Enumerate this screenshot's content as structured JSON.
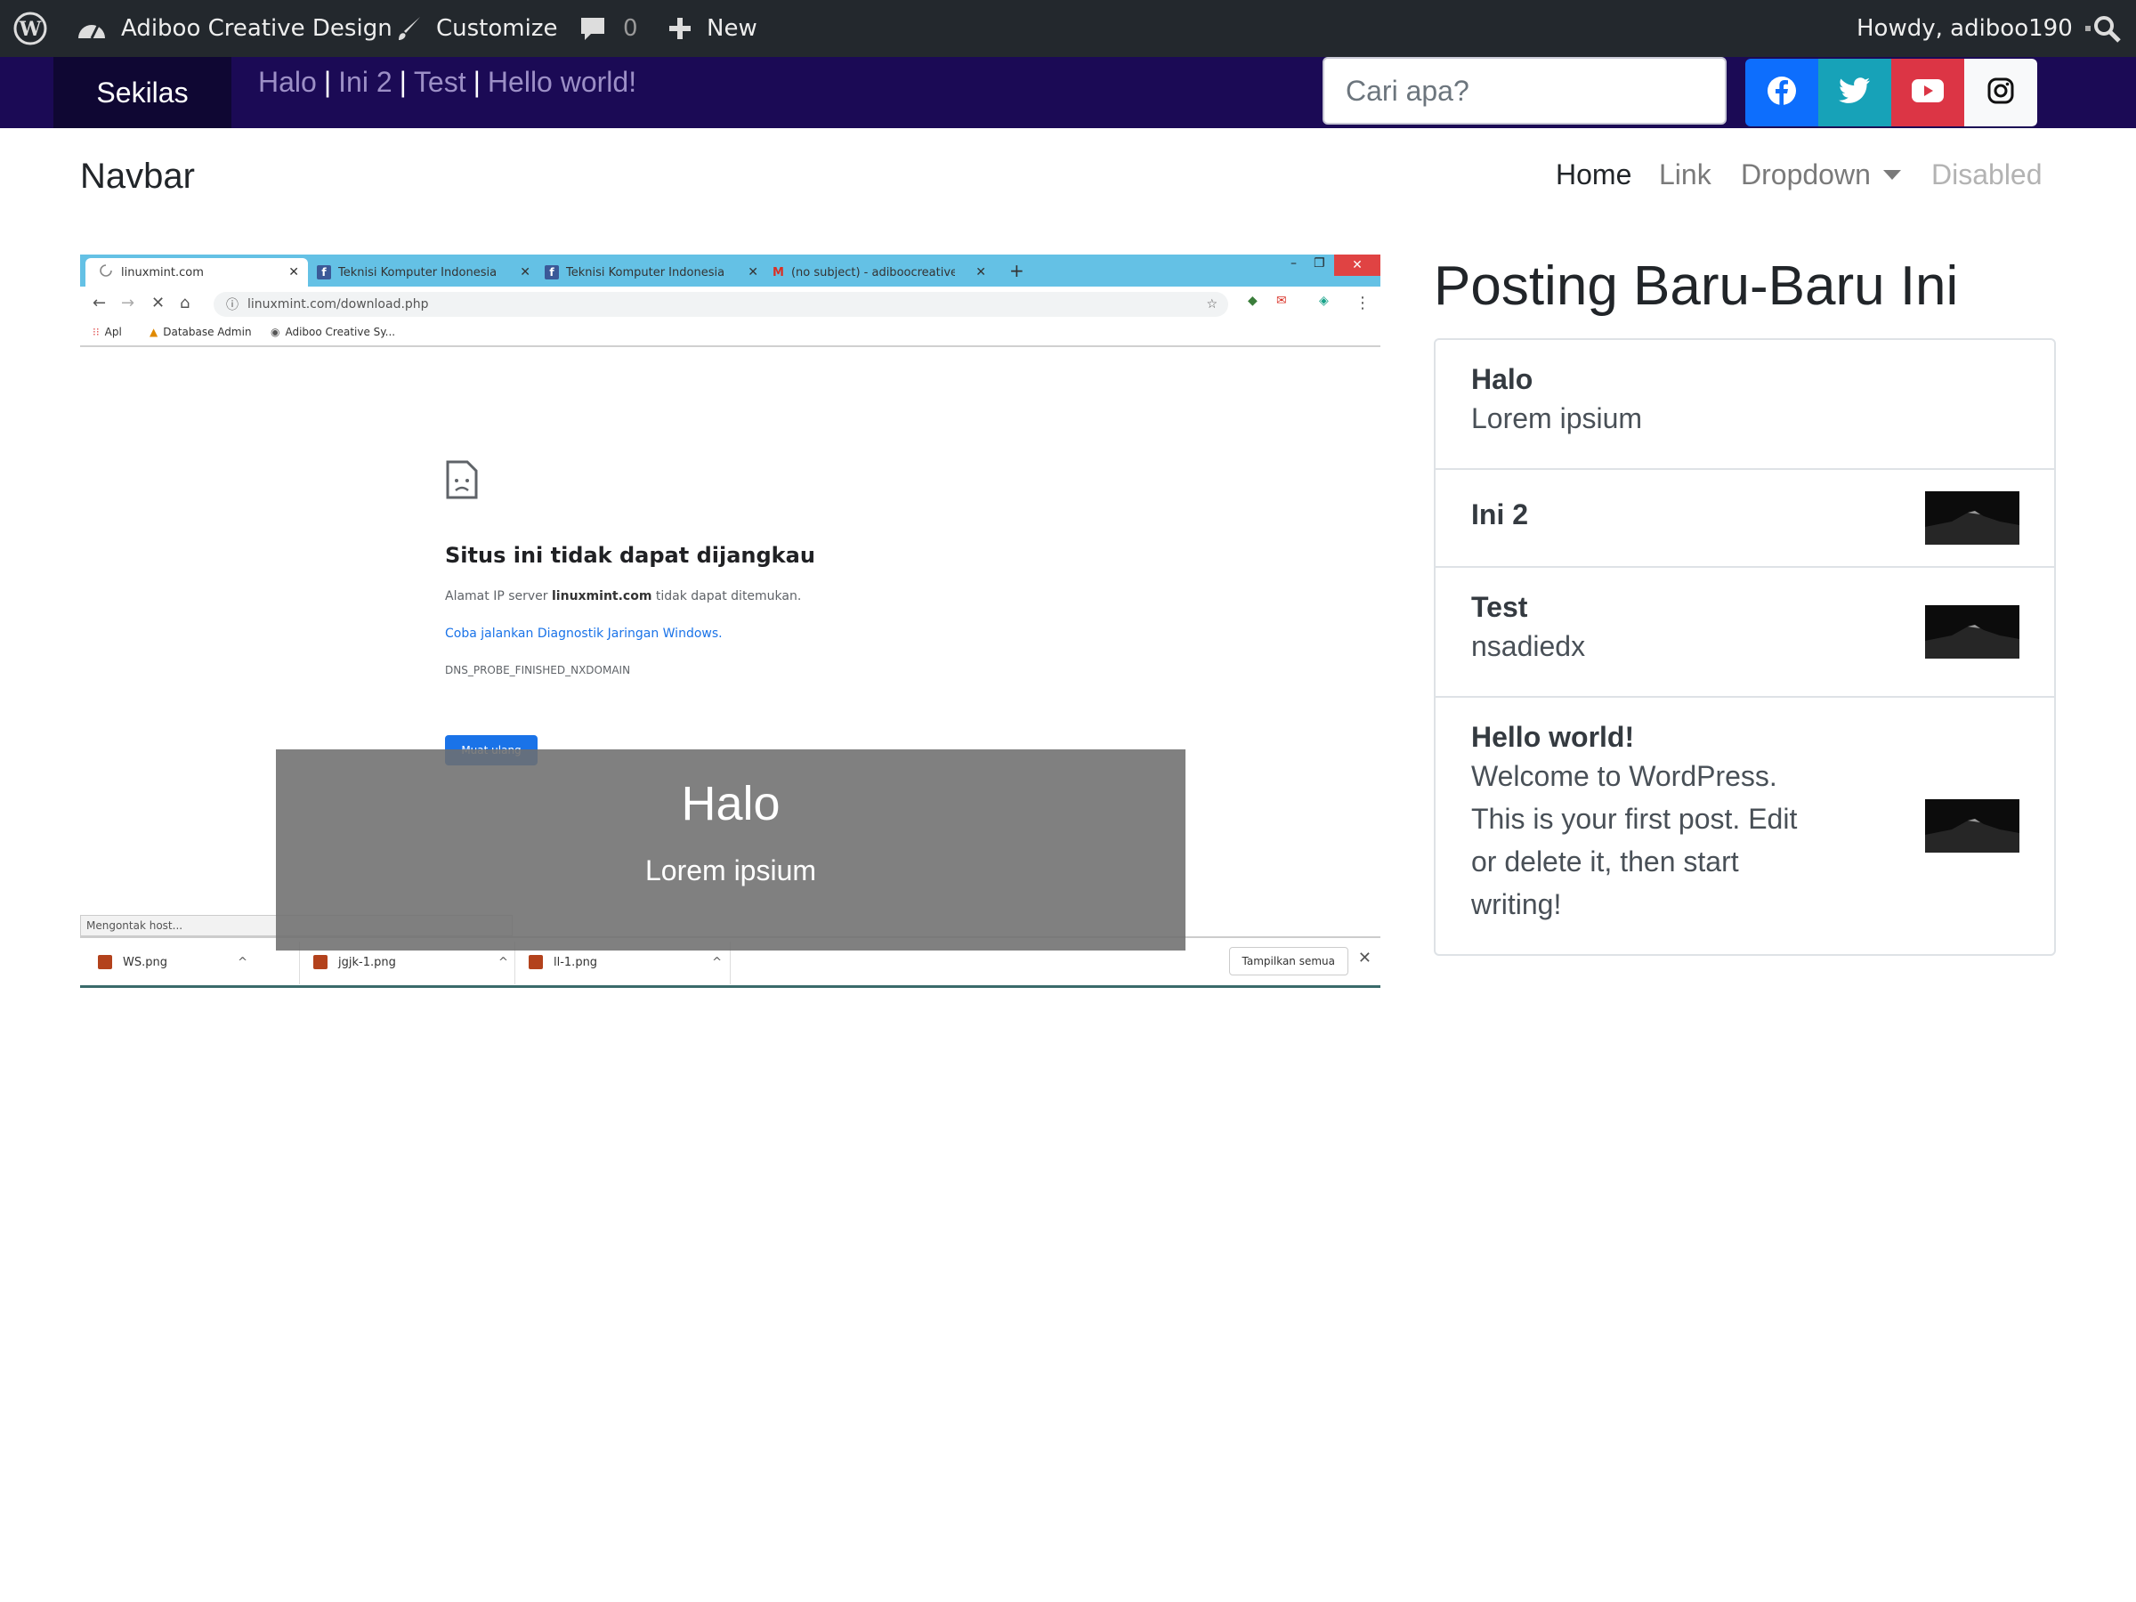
{
  "admin_bar": {
    "site_name": "Adiboo Creative Design",
    "customize": "Customize",
    "comments_count": "0",
    "new": "New",
    "howdy": "Howdy, adiboo190"
  },
  "top_bar": {
    "label": "Sekilas",
    "ticker": [
      "Halo",
      "Ini 2",
      "Test",
      "Hello world!"
    ],
    "ticker_separator": "|",
    "search_placeholder": "Cari apa?",
    "social_icons": [
      "facebook-icon",
      "twitter-icon",
      "youtube-icon",
      "instagram-icon"
    ]
  },
  "navbar": {
    "brand": "Navbar",
    "links": [
      "Home",
      "Link",
      "Dropdown",
      "Disabled"
    ]
  },
  "carousel": {
    "caption_title": "Halo",
    "caption_text": "Lorem ipsium",
    "image": {
      "tabs": [
        "linuxmint.com",
        "Teknisi Komputer Indonesia",
        "Teknisi Komputer Indonesia",
        "(no subject) - adiboocreative@g"
      ],
      "url": "linuxmint.com/download.php",
      "bookmarks": [
        "Apl",
        "Database Admin",
        "Adiboo Creative Sy..."
      ],
      "error_title": "Situs ini tidak dapat dijangkau",
      "error_text_prefix": "Alamat IP server ",
      "error_host": "linuxmint.com",
      "error_text_suffix": " tidak dapat ditemukan.",
      "error_link": "Coba jalankan Diagnostik Jaringan Windows.",
      "error_code": "DNS_PROBE_FINISHED_NXDOMAIN",
      "reload_button": "Muat ulang",
      "status": "Mengontak host...",
      "downloads": [
        "WS.png",
        "jgjk-1.png",
        "ll-1.png"
      ],
      "show_all": "Tampilkan semua"
    }
  },
  "sidebar": {
    "title": "Posting Baru-Baru Ini",
    "posts": [
      {
        "title": "Halo",
        "excerpt": "Lorem ipsium"
      },
      {
        "title": "Ini 2",
        "excerpt": ""
      },
      {
        "title": "Test",
        "excerpt": "nsadiedx"
      },
      {
        "title": "Hello world!",
        "excerpt": "Welcome to WordPress. This is your first post. Edit or delete it, then start writing!"
      }
    ]
  },
  "colors": {
    "admin_bar": "#23282d",
    "top_bar": "#1b0a55",
    "facebook": "#0d6efd",
    "twitter": "#17a2b8",
    "youtube": "#dc3545"
  }
}
